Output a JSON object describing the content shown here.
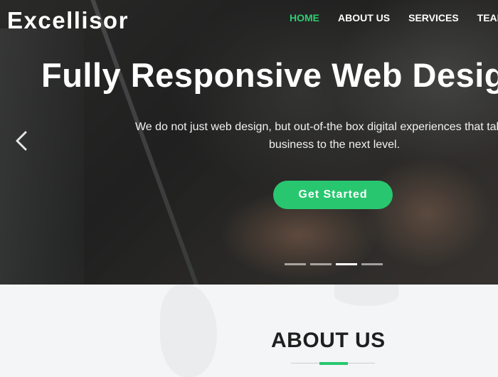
{
  "brand": {
    "logo": "Excellisor"
  },
  "nav": {
    "items": [
      "HOME",
      "ABOUT US",
      "SERVICES",
      "TEAM"
    ],
    "active_index": 0
  },
  "hero": {
    "title": "Fully Responsive Web Design",
    "subtitle_line1": "We do not just web design, but out-of-the box digital experiences that take your",
    "subtitle_line2": "business to the next level.",
    "cta_label": "Get Started",
    "prev_icon": "chevron-left-icon"
  },
  "slider": {
    "slide_count": 4,
    "active_slide": 3
  },
  "about": {
    "title": "ABOUT US"
  },
  "colors": {
    "accent": "#28c76f",
    "nav_active": "#2ecc71",
    "text_dark": "#1f1f1f"
  }
}
